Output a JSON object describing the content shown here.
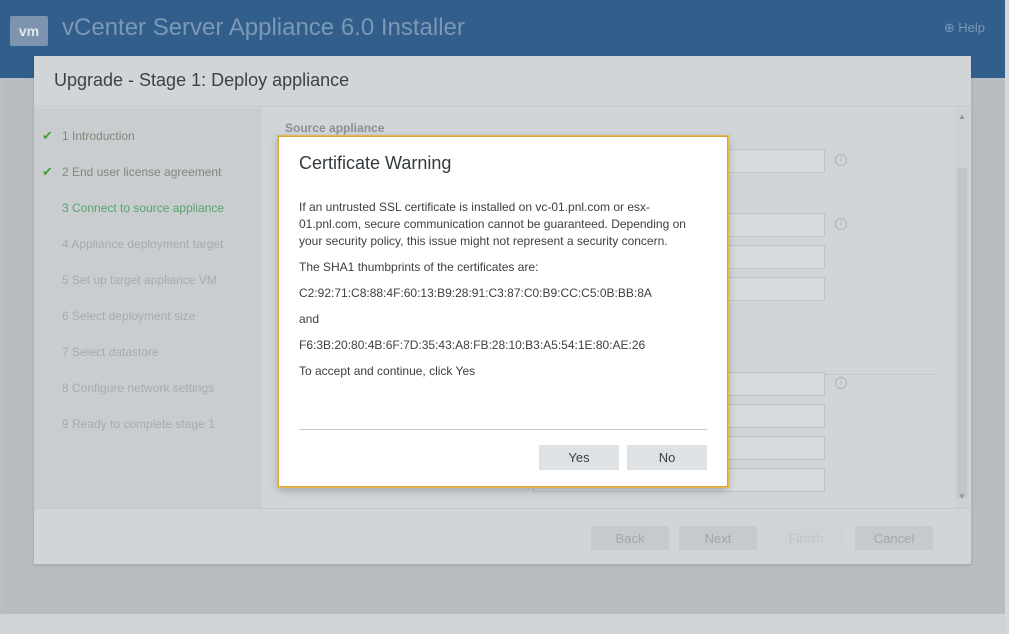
{
  "app": {
    "logo": "vm",
    "title": "vCenter Server Appliance 6.0 Installer",
    "help_label": "Help"
  },
  "wizard": {
    "title": "Upgrade - Stage 1: Deploy appliance",
    "steps": [
      {
        "label": "1 Introduction",
        "status": "done"
      },
      {
        "label": "2 End user license agreement",
        "status": "done"
      },
      {
        "label": "3 Connect to source appliance",
        "status": "current"
      },
      {
        "label": "4 Appliance deployment target",
        "status": "pending"
      },
      {
        "label": "5 Set up target appliance VM",
        "status": "pending"
      },
      {
        "label": "6 Select deployment size",
        "status": "pending"
      },
      {
        "label": "7 Select datastore",
        "status": "pending"
      },
      {
        "label": "8 Configure network settings",
        "status": "pending"
      },
      {
        "label": "9 Ready to complete stage 1",
        "status": "pending"
      }
    ],
    "section_label": "Source appliance",
    "buttons": {
      "back": "Back",
      "next": "Next",
      "finish": "Finish",
      "cancel": "Cancel"
    }
  },
  "dialog": {
    "title": "Certificate Warning",
    "paragraph1": "If an untrusted SSL certificate is installed on vc-01.pnl.com or esx-01.pnl.com, secure communication cannot be guaranteed. Depending on your security policy, this issue might not represent a security concern.",
    "thumbprints_intro": "The SHA1 thumbprints of the certificates are:",
    "thumbprint1": "C2:92:71:C8:88:4F:60:13:B9:28:91:C3:87:C0:B9:CC:C5:0B:BB:8A",
    "and": "and",
    "thumbprint2": "F6:3B:20:80:4B:6F:7D:35:43:A8:FB:28:10:B3:A5:54:1E:80:AE:26",
    "instruction": "To accept and continue, click Yes",
    "yes_label": "Yes",
    "no_label": "No"
  },
  "colors": {
    "header_blue": "#325e8c",
    "check_green": "#4c9c3f",
    "dialog_border": "#d9a53a"
  }
}
